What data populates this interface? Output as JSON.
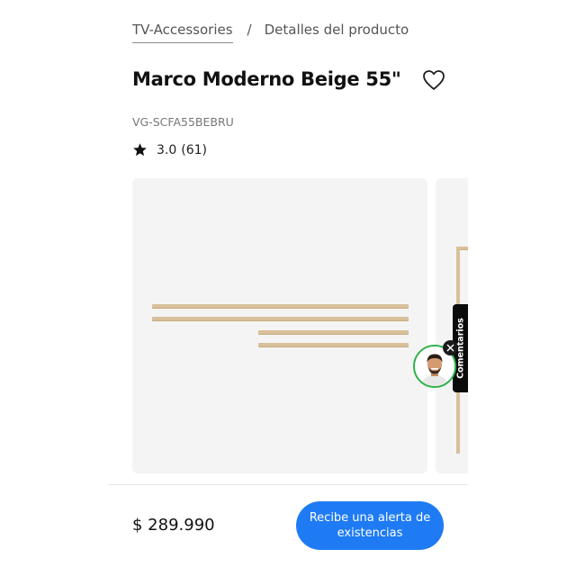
{
  "breadcrumb": {
    "parent": "TV-Accessories",
    "separator": "/",
    "current": "Detalles del producto"
  },
  "product": {
    "title": "Marco Moderno Beige 55\"",
    "sku": "VG-SCFA55BEBRU",
    "rating": {
      "score": "3.0",
      "count": "(61)"
    }
  },
  "feedback": {
    "label": "Comentarios"
  },
  "bottom_bar": {
    "price": "$ 289.990",
    "stock_alert_label": "Recibe una alerta de existencias"
  },
  "icons": {
    "wishlist": "heart-outline-icon",
    "rating": "star-icon",
    "chat_close": "close-icon"
  },
  "colors": {
    "accent": "#1e7bf4",
    "frame": "#d8c09a",
    "chat_ring": "#2fb34a",
    "feedback_bg": "#0b0b0b"
  }
}
